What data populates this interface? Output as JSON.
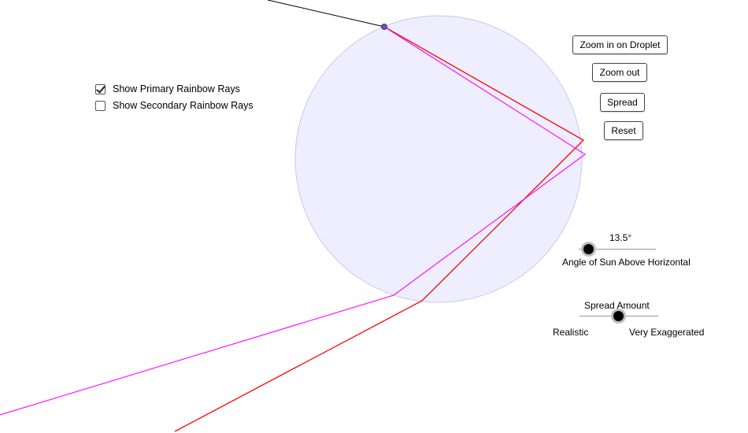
{
  "checkboxes": [
    {
      "label": "Show Primary Rainbow Rays",
      "checked": true
    },
    {
      "label": "Show Secondary Rainbow Rays",
      "checked": false
    }
  ],
  "buttons": {
    "zoom_in": "Zoom in on Droplet",
    "zoom_out": "Zoom out",
    "spread": "Spread",
    "reset": "Reset"
  },
  "sun_slider": {
    "value_text": "13.5°",
    "label": "Angle of Sun Above Horizontal"
  },
  "spread_slider": {
    "title": "Spread Amount",
    "min_label": "Realistic",
    "max_label": "Very Exaggerated"
  },
  "colors": {
    "droplet_fill": "#eeeeff",
    "droplet_stroke": "#c8c8f0",
    "sun_ray": "#000000",
    "red_ray": "#ff0000",
    "violet_ray": "#ff00ff",
    "entry_point": "#5a5ad8"
  }
}
